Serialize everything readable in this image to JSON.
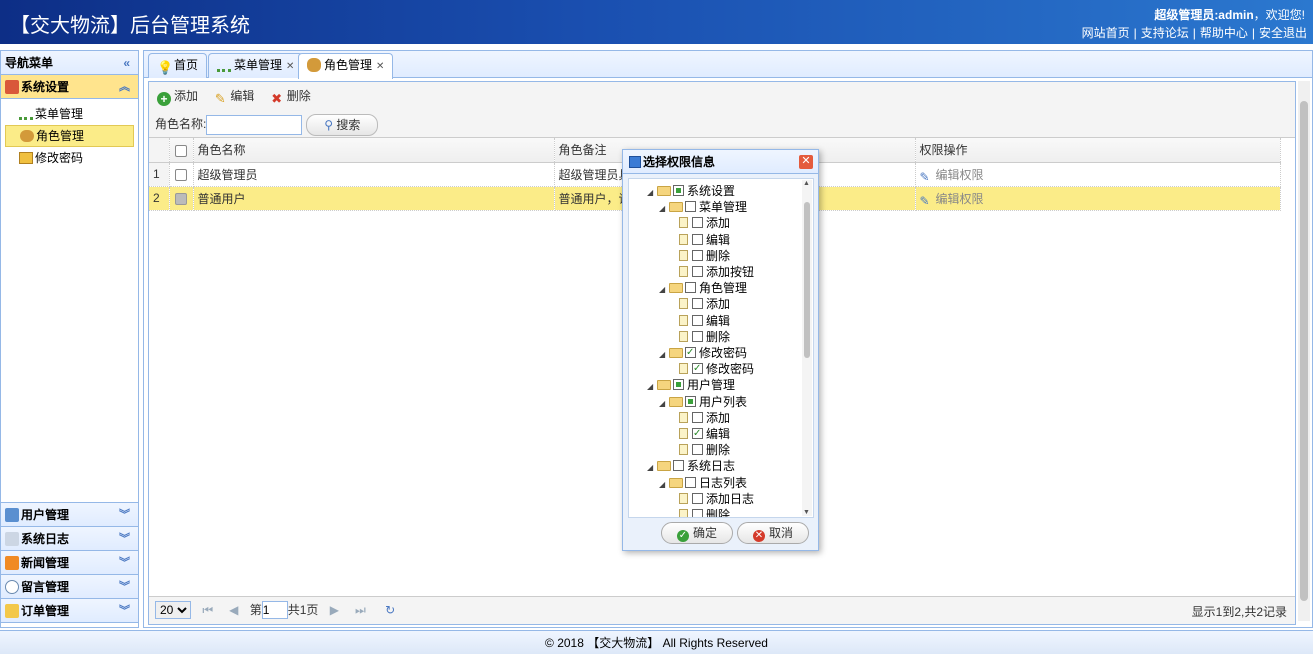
{
  "header": {
    "title": "【交大物流】后台管理系统",
    "welcome_user": "超级管理员:admin",
    "welcome_suffix": "，欢迎您!",
    "links": [
      "网站首页",
      "支持论坛",
      "帮助中心",
      "安全退出"
    ]
  },
  "sidebar": {
    "title": "导航菜单",
    "active_section": "系统设置",
    "items": [
      "菜单管理",
      "角色管理",
      "修改密码"
    ],
    "selected_item": "角色管理",
    "sections": [
      "用户管理",
      "系统日志",
      "新闻管理",
      "留言管理",
      "订单管理"
    ]
  },
  "tabs": [
    {
      "label": "首页",
      "closable": false
    },
    {
      "label": "菜单管理",
      "closable": true
    },
    {
      "label": "角色管理",
      "closable": true,
      "selected": true
    }
  ],
  "toolbar": {
    "add": "添加",
    "edit": "编辑",
    "delete": "删除"
  },
  "search": {
    "label": "角色名称:",
    "value": "",
    "button": "搜索"
  },
  "grid": {
    "columns": [
      "角色名称",
      "角色备注",
      "权限操作"
    ],
    "rows": [
      {
        "num": "1",
        "name": "超级管理员",
        "remark": "超级管理员具",
        "action": "编辑权限",
        "checked": false
      },
      {
        "num": "2",
        "name": "普通用户",
        "remark": "普通用户，请",
        "action": "编辑权限",
        "checked": true
      }
    ]
  },
  "pager": {
    "page_size": "20",
    "page_label": "第",
    "page_value": "1",
    "total_pages": "共1页",
    "info": "显示1到2,共2记录"
  },
  "dialog": {
    "title": "选择权限信息",
    "tree": [
      {
        "label": "系统设置",
        "level": 0,
        "type": "folder",
        "state": "part"
      },
      {
        "label": "菜单管理",
        "level": 1,
        "type": "folder",
        "state": "none"
      },
      {
        "label": "添加",
        "level": 2,
        "type": "file",
        "state": "none"
      },
      {
        "label": "编辑",
        "level": 2,
        "type": "file",
        "state": "none"
      },
      {
        "label": "删除",
        "level": 2,
        "type": "file",
        "state": "none"
      },
      {
        "label": "添加按钮",
        "level": 2,
        "type": "file",
        "state": "none"
      },
      {
        "label": "角色管理",
        "level": 1,
        "type": "folder",
        "state": "none"
      },
      {
        "label": "添加",
        "level": 2,
        "type": "file",
        "state": "none"
      },
      {
        "label": "编辑",
        "level": 2,
        "type": "file",
        "state": "none"
      },
      {
        "label": "删除",
        "level": 2,
        "type": "file",
        "state": "none"
      },
      {
        "label": "修改密码",
        "level": 1,
        "type": "folder",
        "state": "checked"
      },
      {
        "label": "修改密码",
        "level": 2,
        "type": "file",
        "state": "checked"
      },
      {
        "label": "用户管理",
        "level": 0,
        "type": "folder",
        "state": "part"
      },
      {
        "label": "用户列表",
        "level": 1,
        "type": "folder",
        "state": "part"
      },
      {
        "label": "添加",
        "level": 2,
        "type": "file",
        "state": "none"
      },
      {
        "label": "编辑",
        "level": 2,
        "type": "file",
        "state": "checked"
      },
      {
        "label": "删除",
        "level": 2,
        "type": "file",
        "state": "none"
      },
      {
        "label": "系统日志",
        "level": 0,
        "type": "folder",
        "state": "none"
      },
      {
        "label": "日志列表",
        "level": 1,
        "type": "folder",
        "state": "none"
      },
      {
        "label": "添加日志",
        "level": 2,
        "type": "file",
        "state": "none"
      },
      {
        "label": "删除",
        "level": 2,
        "type": "file",
        "state": "none"
      }
    ],
    "ok": "确定",
    "cancel": "取消"
  },
  "footer": "© 2018 【交大物流】 All Rights Reserved",
  "colors": {
    "header_start": "#0d2e86",
    "header_end": "#2b78cf",
    "selected_row": "#fbec88",
    "border": "#95b8e7"
  }
}
